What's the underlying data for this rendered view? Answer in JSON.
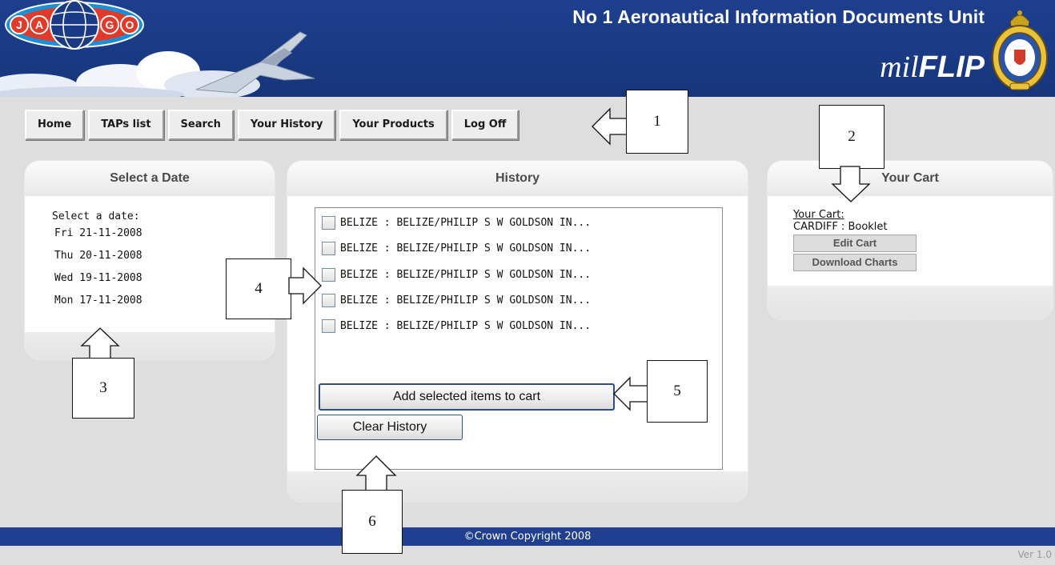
{
  "header": {
    "logo_letters": [
      "J",
      "A",
      "G",
      "O"
    ],
    "title": "No 1 Aeronautical Information Documents Unit",
    "brand_mil": "mil",
    "brand_flip": "FLIP"
  },
  "nav": {
    "items": [
      "Home",
      "TAPs list",
      "Search",
      "Your History",
      "Your Products",
      "Log Off"
    ]
  },
  "date_panel": {
    "title": "Select a Date",
    "label": "Select a date:",
    "dates": [
      "Fri 21-11-2008",
      "Thu 20-11-2008",
      "Wed 19-11-2008",
      "Mon 17-11-2008"
    ]
  },
  "history_panel": {
    "title": "History",
    "items": [
      "BELIZE : BELIZE/PHILIP S W GOLDSON IN...",
      "BELIZE : BELIZE/PHILIP S W GOLDSON IN...",
      "BELIZE : BELIZE/PHILIP S W GOLDSON IN...",
      "BELIZE : BELIZE/PHILIP S W GOLDSON IN...",
      "BELIZE : BELIZE/PHILIP S W GOLDSON IN..."
    ],
    "add_button": "Add selected items to cart",
    "clear_button": "Clear History"
  },
  "cart_panel": {
    "title": "Your Cart",
    "link": "Your Cart:",
    "item": "CARDIFF : Booklet",
    "edit_button": "Edit Cart",
    "download_button": "Download Charts"
  },
  "footer": {
    "copyright": "©Crown Copyright 2008",
    "version": "Ver 1.0"
  },
  "callouts": [
    "1",
    "2",
    "3",
    "4",
    "5",
    "6"
  ],
  "colors": {
    "header_blue": "#1d3f8e",
    "footer_blue": "#213f91",
    "page_bg": "#dedede"
  }
}
